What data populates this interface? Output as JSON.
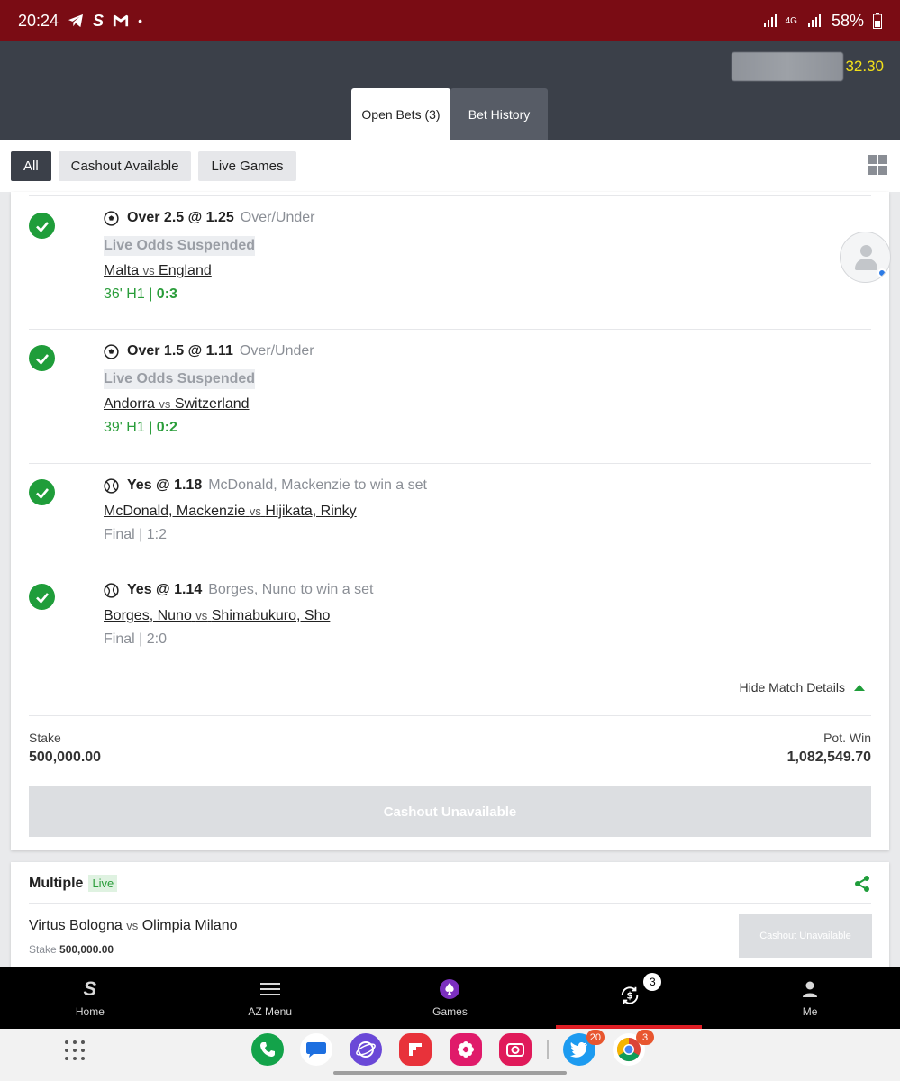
{
  "status_bar": {
    "time": "20:24",
    "battery": "58%",
    "network": "4G"
  },
  "header": {
    "balance_amount": "32.30",
    "tabs": [
      {
        "label": "Open Bets (3)",
        "active": true
      },
      {
        "label": "Bet History",
        "active": false
      }
    ]
  },
  "filters": {
    "chips": [
      {
        "label": "All",
        "active": true
      },
      {
        "label": "Cashout Available",
        "active": false
      },
      {
        "label": "Live Games",
        "active": false
      }
    ]
  },
  "bet": {
    "legs": [
      {
        "sport_icon": "soccer-ball-icon",
        "selection": "Over 2.5 @ 1.25",
        "market": "Over/Under",
        "suspended": "Live Odds Suspended",
        "home": "Malta",
        "vs": "vs",
        "away": "England",
        "status_prefix": "36' H1 | ",
        "status_score": "0:3",
        "live": true
      },
      {
        "sport_icon": "soccer-ball-icon",
        "selection": "Over 1.5 @ 1.11",
        "market": "Over/Under",
        "suspended": "Live Odds Suspended",
        "home": "Andorra",
        "vs": "vs",
        "away": "Switzerland",
        "status_prefix": "39' H1 | ",
        "status_score": "0:2",
        "live": true
      },
      {
        "sport_icon": "tennis-ball-icon",
        "selection": "Yes @ 1.18",
        "market": "McDonald, Mackenzie to win a set",
        "home": "McDonald, Mackenzie",
        "vs": "vs",
        "away": "Hijikata, Rinky",
        "status": "Final | 1:2",
        "live": false
      },
      {
        "sport_icon": "tennis-ball-icon",
        "selection": "Yes @ 1.14",
        "market": "Borges, Nuno to win a set",
        "home": "Borges, Nuno",
        "vs": "vs",
        "away": "Shimabukuro, Sho",
        "status": "Final | 2:0",
        "live": false
      }
    ],
    "hide_details": "Hide Match Details",
    "stake_label": "Stake",
    "stake_value": "500,000.00",
    "pot_win_label": "Pot. Win",
    "pot_win_value": "1,082,549.70",
    "cashout_label": "Cashout Unavailable"
  },
  "second_bet": {
    "title": "Multiple",
    "live_label": "Live",
    "home": "Virtus Bologna",
    "vs": "vs",
    "away": "Olimpia Milano",
    "stake_label": "Stake",
    "stake_value": "500,000.00",
    "cashout_label": "Cashout Unavailable"
  },
  "bottom_nav": {
    "items": [
      {
        "label": "Home",
        "icon": "sportybet-logo-icon"
      },
      {
        "label": "AZ Menu",
        "icon": "hamburger-menu-icon"
      },
      {
        "label": "Games",
        "icon": "spade-icon"
      },
      {
        "label": "",
        "icon": "cashout-icon",
        "badge": "3",
        "active": true
      },
      {
        "label": "Me",
        "icon": "person-icon"
      }
    ]
  },
  "dock": {
    "badges": {
      "twitter": "20",
      "chrome": "3"
    }
  },
  "colors": {
    "status_bar": "#7a0c14",
    "header": "#3b4049",
    "accent_green": "#1f9d3a",
    "balance_yellow": "#f2e01a",
    "active_nav_red": "#e01e25"
  }
}
